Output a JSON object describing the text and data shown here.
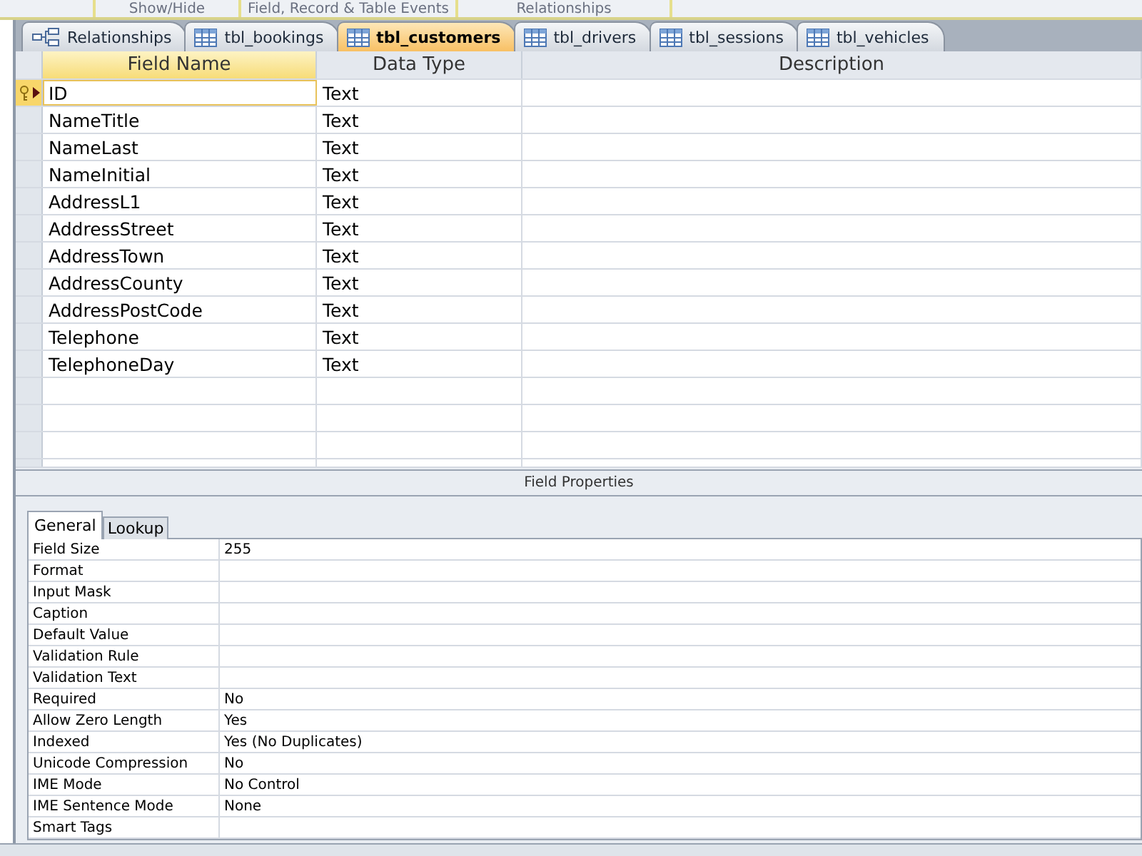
{
  "ribbon_groups": [
    "Show/Hide",
    "Field, Record & Table Events",
    "Relationships"
  ],
  "tabs": [
    {
      "label": "Relationships",
      "kind": "relationships",
      "selected": false
    },
    {
      "label": "tbl_bookings",
      "kind": "table",
      "selected": false
    },
    {
      "label": "tbl_customers",
      "kind": "table",
      "selected": true
    },
    {
      "label": "tbl_drivers",
      "kind": "table",
      "selected": false
    },
    {
      "label": "tbl_sessions",
      "kind": "table",
      "selected": false
    },
    {
      "label": "tbl_vehicles",
      "kind": "table",
      "selected": false
    }
  ],
  "grid": {
    "columns": [
      "Field Name",
      "Data Type",
      "Description"
    ],
    "rows": [
      {
        "field_name": "ID",
        "data_type": "Text",
        "primary_key": true,
        "selected": true
      },
      {
        "field_name": "NameTitle",
        "data_type": "Text",
        "primary_key": false,
        "selected": false
      },
      {
        "field_name": "NameLast",
        "data_type": "Text",
        "primary_key": false,
        "selected": false
      },
      {
        "field_name": "NameInitial",
        "data_type": "Text",
        "primary_key": false,
        "selected": false
      },
      {
        "field_name": "AddressL1",
        "data_type": "Text",
        "primary_key": false,
        "selected": false
      },
      {
        "field_name": "AddressStreet",
        "data_type": "Text",
        "primary_key": false,
        "selected": false
      },
      {
        "field_name": "AddressTown",
        "data_type": "Text",
        "primary_key": false,
        "selected": false
      },
      {
        "field_name": "AddressCounty",
        "data_type": "Text",
        "primary_key": false,
        "selected": false
      },
      {
        "field_name": "AddressPostCode",
        "data_type": "Text",
        "primary_key": false,
        "selected": false
      },
      {
        "field_name": "Telephone",
        "data_type": "Text",
        "primary_key": false,
        "selected": false
      },
      {
        "field_name": "TelephoneDay",
        "data_type": "Text",
        "primary_key": false,
        "selected": false
      }
    ]
  },
  "field_properties": {
    "title": "Field Properties",
    "tabs": [
      {
        "label": "General",
        "selected": true
      },
      {
        "label": "Lookup",
        "selected": false
      }
    ],
    "properties": [
      {
        "name": "Field Size",
        "value": "255"
      },
      {
        "name": "Format"
      },
      {
        "name": "Input Mask"
      },
      {
        "name": "Caption"
      },
      {
        "name": "Default Value"
      },
      {
        "name": "Validation Rule"
      },
      {
        "name": "Validation Text"
      },
      {
        "name": "Required",
        "value": "No"
      },
      {
        "name": "Allow Zero Length",
        "value": "Yes"
      },
      {
        "name": "Indexed",
        "value": "Yes (No Duplicates)"
      },
      {
        "name": "Unicode Compression",
        "value": "No"
      },
      {
        "name": "IME Mode",
        "value": "No Control"
      },
      {
        "name": "IME Sentence Mode",
        "value": "None"
      },
      {
        "name": "Smart Tags"
      }
    ]
  }
}
